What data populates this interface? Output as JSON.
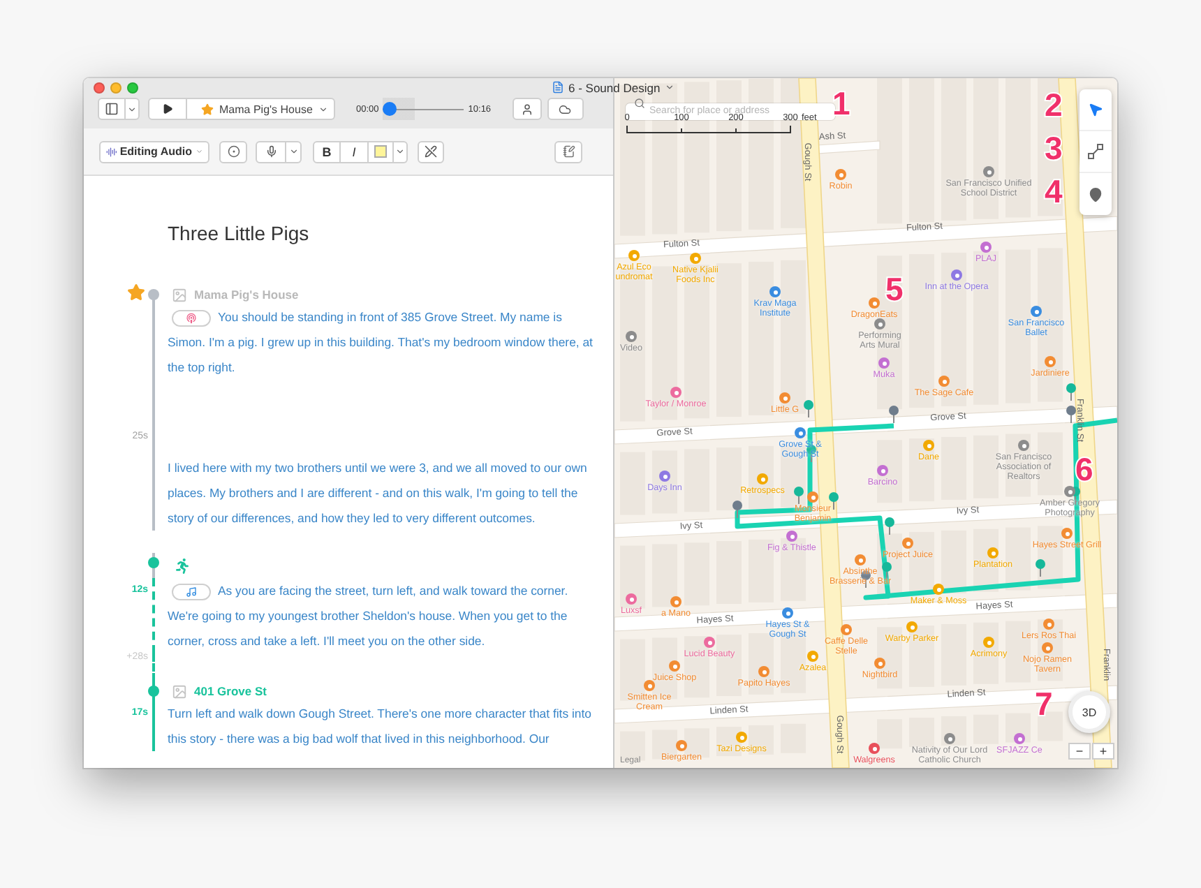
{
  "window": {
    "title": "6 - Sound Design"
  },
  "toolbar": {
    "chapter": "Mama Pig's House",
    "time_start": "00:00",
    "time_end": "10:16",
    "level": 0
  },
  "format_bar": {
    "mode": "Editing Audio",
    "bold": "B",
    "italic": "I"
  },
  "document": {
    "title": "Three Little Pigs",
    "rows": [
      {
        "kind": "heading",
        "text": "Mama Pig's House",
        "starred": true,
        "active": false,
        "dashed": false
      },
      {
        "kind": "paragraph",
        "chip": {
          "kind": "audio"
        },
        "text": "You should be standing in front of 385 Grove Street. My name is Simon. I'm a pig. I grew up in this building. That's my bedroom window there, at the top right.",
        "active": false,
        "dashed": false
      },
      {
        "kind": "gap",
        "time": "25s",
        "active": false,
        "dashed": false
      },
      {
        "kind": "paragraph",
        "text": "I lived here with my two brothers until we were 3, and we all moved to our own places. My brothers and I are different - and on this walk, I'm going to tell the story of our differences, and how they led to very different outcomes.",
        "active": false,
        "dashed": false
      },
      {
        "kind": "action",
        "active": true,
        "dashed": false
      },
      {
        "kind": "paragraph",
        "chip": {
          "kind": "music"
        },
        "time": "12s",
        "text": "As you are facing the street, turn left, and walk toward the corner. We're going to my youngest brother Sheldon's house. When you get to the corner, cross and take a left. I'll meet you on the other side.",
        "active": true,
        "dashed": true
      },
      {
        "kind": "gap",
        "time": "+28s",
        "active": true,
        "dashed": true
      },
      {
        "kind": "heading",
        "text": "401 Grove St",
        "starred": false,
        "active": true,
        "dashed": false
      },
      {
        "kind": "paragraph",
        "time": "17s",
        "text": "Turn left and walk down Gough Street. There's one more character that fits into this story - there was a big bad wolf that lived in this neighborhood. Our",
        "active": true,
        "dashed": false
      }
    ]
  },
  "map": {
    "search_placeholder": "Search for place or address",
    "scale": [
      "0",
      "100",
      "200",
      "300"
    ],
    "scale_unit": "feet",
    "streets": [
      "Ash St",
      "Gough St",
      "Fulton St",
      "Fulton St",
      "Grove St",
      "Grove St",
      "Ivy St",
      "Ivy St",
      "Hayes St",
      "Hayes St",
      "Linden St",
      "Linden St",
      "Franklin St",
      "Franklin",
      "Gough St"
    ],
    "places": [
      {
        "name": "Robin",
        "kind": "food"
      },
      {
        "name": "San Francisco Unified School District",
        "kind": "landmark"
      },
      {
        "name": "Azul Eco undromat",
        "kind": "shop"
      },
      {
        "name": "Native Kjalii Foods Inc",
        "kind": "shop"
      },
      {
        "name": "Krav Maga Institute",
        "kind": "fitness"
      },
      {
        "name": "PLAJ",
        "kind": "nightlife"
      },
      {
        "name": "Inn at the Opera",
        "kind": "hotel"
      },
      {
        "name": "DragonEats",
        "kind": "food"
      },
      {
        "name": "Performing Arts Mural",
        "kind": "landmark"
      },
      {
        "name": "San Francisco Ballet",
        "kind": "fitness"
      },
      {
        "name": "Muka",
        "kind": "nightlife"
      },
      {
        "name": "The Sage Cafe",
        "kind": "food"
      },
      {
        "name": "Jardiniere",
        "kind": "food"
      },
      {
        "name": "Video",
        "kind": "landmark"
      },
      {
        "name": "Taylor / Monroe",
        "kind": "beauty"
      },
      {
        "name": "Little G",
        "kind": "food"
      },
      {
        "name": "Grove St & Gough St",
        "kind": "transit"
      },
      {
        "name": "Dane",
        "kind": "shop"
      },
      {
        "name": "Barcino",
        "kind": "nightlife"
      },
      {
        "name": "San Francisco Association of Realtors",
        "kind": "landmark"
      },
      {
        "name": "Days Inn",
        "kind": "hotel"
      },
      {
        "name": "Retrospecs",
        "kind": "shop"
      },
      {
        "name": "Monsieur Benjamin",
        "kind": "food"
      },
      {
        "name": "Amber Gregory Photography",
        "kind": "landmark"
      },
      {
        "name": "Fig & Thistle",
        "kind": "nightlife"
      },
      {
        "name": "Hayes Street Grill",
        "kind": "food"
      },
      {
        "name": "Project Juice",
        "kind": "food"
      },
      {
        "name": "Plantation",
        "kind": "shop"
      },
      {
        "name": "Absinthe Brasserie & Bar",
        "kind": "food"
      },
      {
        "name": "Maker & Moss",
        "kind": "shop"
      },
      {
        "name": "Luxsf",
        "kind": "beauty"
      },
      {
        "name": "a Mano",
        "kind": "food"
      },
      {
        "name": "Hayes St & Gough St",
        "kind": "transit"
      },
      {
        "name": "Caffe Delle Stelle",
        "kind": "food"
      },
      {
        "name": "Warby Parker",
        "kind": "shop"
      },
      {
        "name": "Lers Ros Thai",
        "kind": "food"
      },
      {
        "name": "Acrimony",
        "kind": "shop"
      },
      {
        "name": "Nojo Ramen Tavern",
        "kind": "food"
      },
      {
        "name": "Lucid Beauty",
        "kind": "beauty"
      },
      {
        "name": "Juice Shop",
        "kind": "food"
      },
      {
        "name": "Azalea",
        "kind": "shop"
      },
      {
        "name": "Papito Hayes",
        "kind": "food"
      },
      {
        "name": "Nightbird",
        "kind": "food"
      },
      {
        "name": "Smitten Ice Cream",
        "kind": "food"
      },
      {
        "name": "Tazi Designs",
        "kind": "shop"
      },
      {
        "name": "Walgreens",
        "kind": "pharmacy"
      },
      {
        "name": "Nativity of Our Lord Catholic Church",
        "kind": "landmark"
      },
      {
        "name": "SFJAZZ Ce",
        "kind": "nightlife"
      },
      {
        "name": "Biergarten",
        "kind": "food"
      }
    ],
    "callouts": [
      "1",
      "2",
      "3",
      "4",
      "5",
      "6",
      "7"
    ],
    "compass": "3D",
    "zoom_out": "−",
    "zoom_in": "+",
    "legal": "Legal"
  }
}
